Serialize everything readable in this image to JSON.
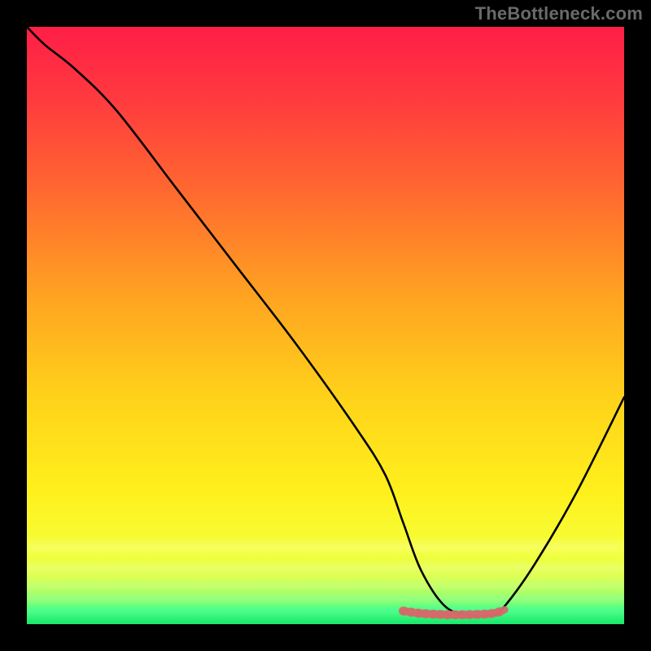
{
  "watermark": "TheBottleneck.com",
  "chart_data": {
    "type": "line",
    "title": "",
    "xlabel": "",
    "ylabel": "",
    "xlim": [
      0,
      100
    ],
    "ylim": [
      0,
      100
    ],
    "grid": false,
    "legend": false,
    "series": [
      {
        "name": "bottleneck-curve",
        "x": [
          0,
          3,
          8,
          15,
          25,
          35,
          45,
          55,
          60,
          63,
          66,
          70,
          74,
          78,
          80,
          85,
          92,
          100
        ],
        "values": [
          100,
          97,
          93,
          86,
          73,
          60,
          47,
          33,
          25,
          17,
          9,
          3,
          1.5,
          1.5,
          3,
          10,
          22,
          38
        ]
      },
      {
        "name": "flat-bottom-marker",
        "x": [
          63,
          66,
          70,
          74,
          78,
          80
        ],
        "values": [
          2.2,
          1.8,
          1.6,
          1.6,
          1.8,
          2.4
        ]
      }
    ],
    "gradient_stops": [
      {
        "pos": 0.0,
        "color": "#ff1e47"
      },
      {
        "pos": 0.12,
        "color": "#ff3a3f"
      },
      {
        "pos": 0.28,
        "color": "#ff6a2f"
      },
      {
        "pos": 0.45,
        "color": "#ffa321"
      },
      {
        "pos": 0.62,
        "color": "#ffd21a"
      },
      {
        "pos": 0.78,
        "color": "#fff01c"
      },
      {
        "pos": 0.88,
        "color": "#f3ff3a"
      },
      {
        "pos": 0.92,
        "color": "#dcff55"
      },
      {
        "pos": 0.955,
        "color": "#9aff6a"
      },
      {
        "pos": 0.975,
        "color": "#4eff7a"
      },
      {
        "pos": 1.0,
        "color": "#17e86e"
      }
    ],
    "glow_lines": [
      {
        "y_frac": 0.87,
        "color": "#ffffd0",
        "height": 6,
        "blur": 5
      },
      {
        "y_frac": 0.905,
        "color": "#fbffa8",
        "height": 5,
        "blur": 4
      },
      {
        "y_frac": 0.935,
        "color": "#d9ff9a",
        "height": 5,
        "blur": 4
      },
      {
        "y_frac": 0.958,
        "color": "#a6ffb0",
        "height": 5,
        "blur": 4
      },
      {
        "y_frac": 0.978,
        "color": "#5affc4",
        "height": 5,
        "blur": 4
      }
    ],
    "bottom_marker_color": "#d46a6a"
  }
}
